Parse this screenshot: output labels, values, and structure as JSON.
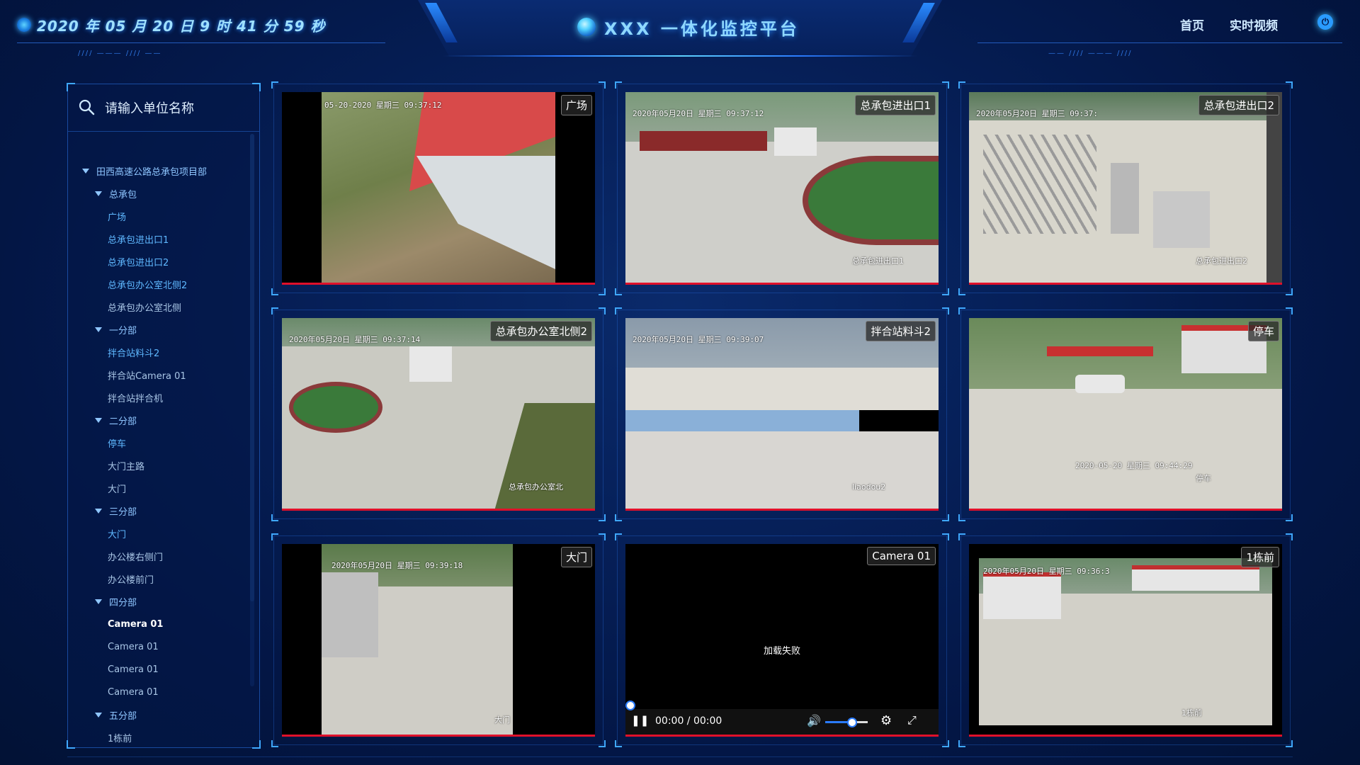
{
  "header": {
    "datetime": "2020 年 05 月 20 日 9 时 41 分 59 秒",
    "title": "XXX 一体化监控平台",
    "nav": [
      {
        "label": "首页"
      },
      {
        "label": "实时视频"
      }
    ],
    "power_icon": "power-icon"
  },
  "sidebar": {
    "search_placeholder": "请输入单位名称",
    "tree": [
      {
        "label": "田西高速公路总承包项目部",
        "level": 0,
        "expanded": true
      },
      {
        "label": "总承包",
        "level": 1,
        "expanded": true
      },
      {
        "label": "广场",
        "level": 2
      },
      {
        "label": "总承包进出口1",
        "level": 2
      },
      {
        "label": "总承包进出口2",
        "level": 2
      },
      {
        "label": "总承包办公室北侧2",
        "level": 2
      },
      {
        "label": "总承包办公室北侧",
        "level": 2,
        "dim": true
      },
      {
        "label": "一分部",
        "level": 1,
        "expanded": true
      },
      {
        "label": "拌合站料斗2",
        "level": 2
      },
      {
        "label": "拌合站Camera 01",
        "level": 2,
        "dim": true
      },
      {
        "label": "拌合站拌合机",
        "level": 2,
        "dim": true
      },
      {
        "label": "二分部",
        "level": 1,
        "expanded": true
      },
      {
        "label": "停车",
        "level": 2
      },
      {
        "label": "大门主路",
        "level": 2,
        "dim": true
      },
      {
        "label": "大门",
        "level": 2,
        "dim": true
      },
      {
        "label": "三分部",
        "level": 1,
        "expanded": true
      },
      {
        "label": "大门",
        "level": 2
      },
      {
        "label": "办公楼右侧门",
        "level": 2,
        "dim": true
      },
      {
        "label": "办公楼前门",
        "level": 2,
        "dim": true
      },
      {
        "label": "四分部",
        "level": 1,
        "expanded": true
      },
      {
        "label": "Camera 01",
        "level": 2,
        "active": true
      },
      {
        "label": "Camera 01",
        "level": 2,
        "dim": true
      },
      {
        "label": "Camera 01",
        "level": 2,
        "dim": true
      },
      {
        "label": "Camera 01",
        "level": 2,
        "dim": true
      },
      {
        "label": "五分部",
        "level": 1,
        "expanded": true
      },
      {
        "label": "1栋前",
        "level": 2,
        "dim": true
      }
    ]
  },
  "videos": [
    {
      "label": "广场",
      "timestamp": "05-20-2020  星期三  09:37:12",
      "caption": ""
    },
    {
      "label": "总承包进出口1",
      "timestamp": "2020年05月20日  星期三  09:37:12",
      "caption": "总承包进出口1"
    },
    {
      "label": "总承包进出口2",
      "timestamp": "2020年05月20日  星期三  09:37:",
      "caption": "总承包进出口2"
    },
    {
      "label": "总承包办公室北侧2",
      "timestamp": "2020年05月20日  星期三  09:37:14",
      "caption": "总承包办公室北"
    },
    {
      "label": "拌合站料斗2",
      "timestamp": "2020年05月20日  星期三  09:39:07",
      "caption": "liaodou2"
    },
    {
      "label": "停车",
      "timestamp": "2020-05-20  星期三  09:44:29",
      "caption": "停车"
    },
    {
      "label": "大门",
      "timestamp": "2020年05月20日  星期三  09:39:18",
      "caption": "大门"
    },
    {
      "label": "Camera 01",
      "status": "加载失败",
      "time": "00:00 / 00:00",
      "volume": 0.6
    },
    {
      "label": "1栋前",
      "timestamp": "2020年05月20日  星期三  09:36:3",
      "caption": "1栋前"
    }
  ]
}
